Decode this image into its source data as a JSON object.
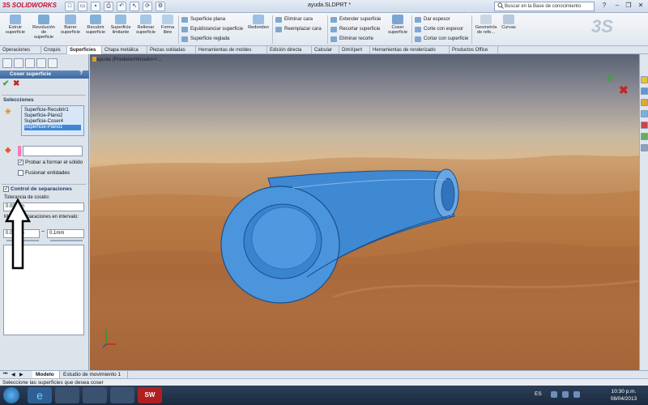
{
  "app": {
    "logo": "SOLIDWORKS",
    "doc_title": "ayuda.SLDPRT *"
  },
  "search": {
    "placeholder": "Buscar en la Base de conocimiento"
  },
  "ribbon": {
    "big_buttons": [
      {
        "label": "Extruir\nsuperficie"
      },
      {
        "label": "Revolución\nde\nsuperficie"
      },
      {
        "label": "Barrer\nsuperficie"
      },
      {
        "label": "Recubrir\nsuperficie"
      },
      {
        "label": "Superficie\nlimitante"
      },
      {
        "label": "Rellenar\nsuperficie"
      },
      {
        "label": "Forma\nlibre"
      }
    ],
    "col1": [
      "Superficie plana",
      "Equidistanciar superficie",
      "Superficie reglada"
    ],
    "redondeo": "Redondeo",
    "col2": [
      "Eliminar cara",
      "Reemplazar cara"
    ],
    "col3": [
      "Extender superficie",
      "Recortar superficie",
      "Eliminar recorte"
    ],
    "coser": "Coser\nsuperficie",
    "col4": [
      "Dar espesor",
      "Corte con espesor",
      "Cortar con superficie"
    ],
    "geometria": "Geometría\nde refe...",
    "curvas": "Curvas"
  },
  "tabs": [
    "Operaciones",
    "Croquis",
    "Superficies",
    "Chapa metálica",
    "Piezas soldadas",
    "Herramientas de moldes",
    "Edición directa",
    "Calcular",
    "DimXpert",
    "Herramientas de renderizado",
    "Productos Office"
  ],
  "tree": {
    "label": "ayuda  (Predeterminado<<..."
  },
  "panel": {
    "title": "Coser superficie",
    "help": "?",
    "selecciones_title": "Selecciones",
    "selections": [
      "Superficie-Recubrir1",
      "Superficie-Plano2",
      "Superficie-Coser4",
      "Superficie-Plano1"
    ],
    "probar_label": "Probar a formar el sólido",
    "fusionar_label": "Fusionar entidades",
    "control_title": "Control de separaciones",
    "tolerancia_label": "Tolerancia de cosido:",
    "tolerancia_value": "0.0025in",
    "mostrar_label": "Mostrar separaciones en intervalo:",
    "range_min": "0.0025in",
    "range_sep": "~",
    "range_max": "0.1mm"
  },
  "bottom_tabs": [
    "Modelo",
    "Estudio de movimiento 1"
  ],
  "status": "Seleccione las superficies que desea coser",
  "taskbar": {
    "lang": "ES",
    "time": "10:30 p.m.",
    "date": "08/04/2013"
  },
  "colors": {
    "accent": "#3b6aa3",
    "model_blue": "#3f88d2",
    "ok_green": "#3aa63a",
    "cancel_red": "#cc2222"
  }
}
